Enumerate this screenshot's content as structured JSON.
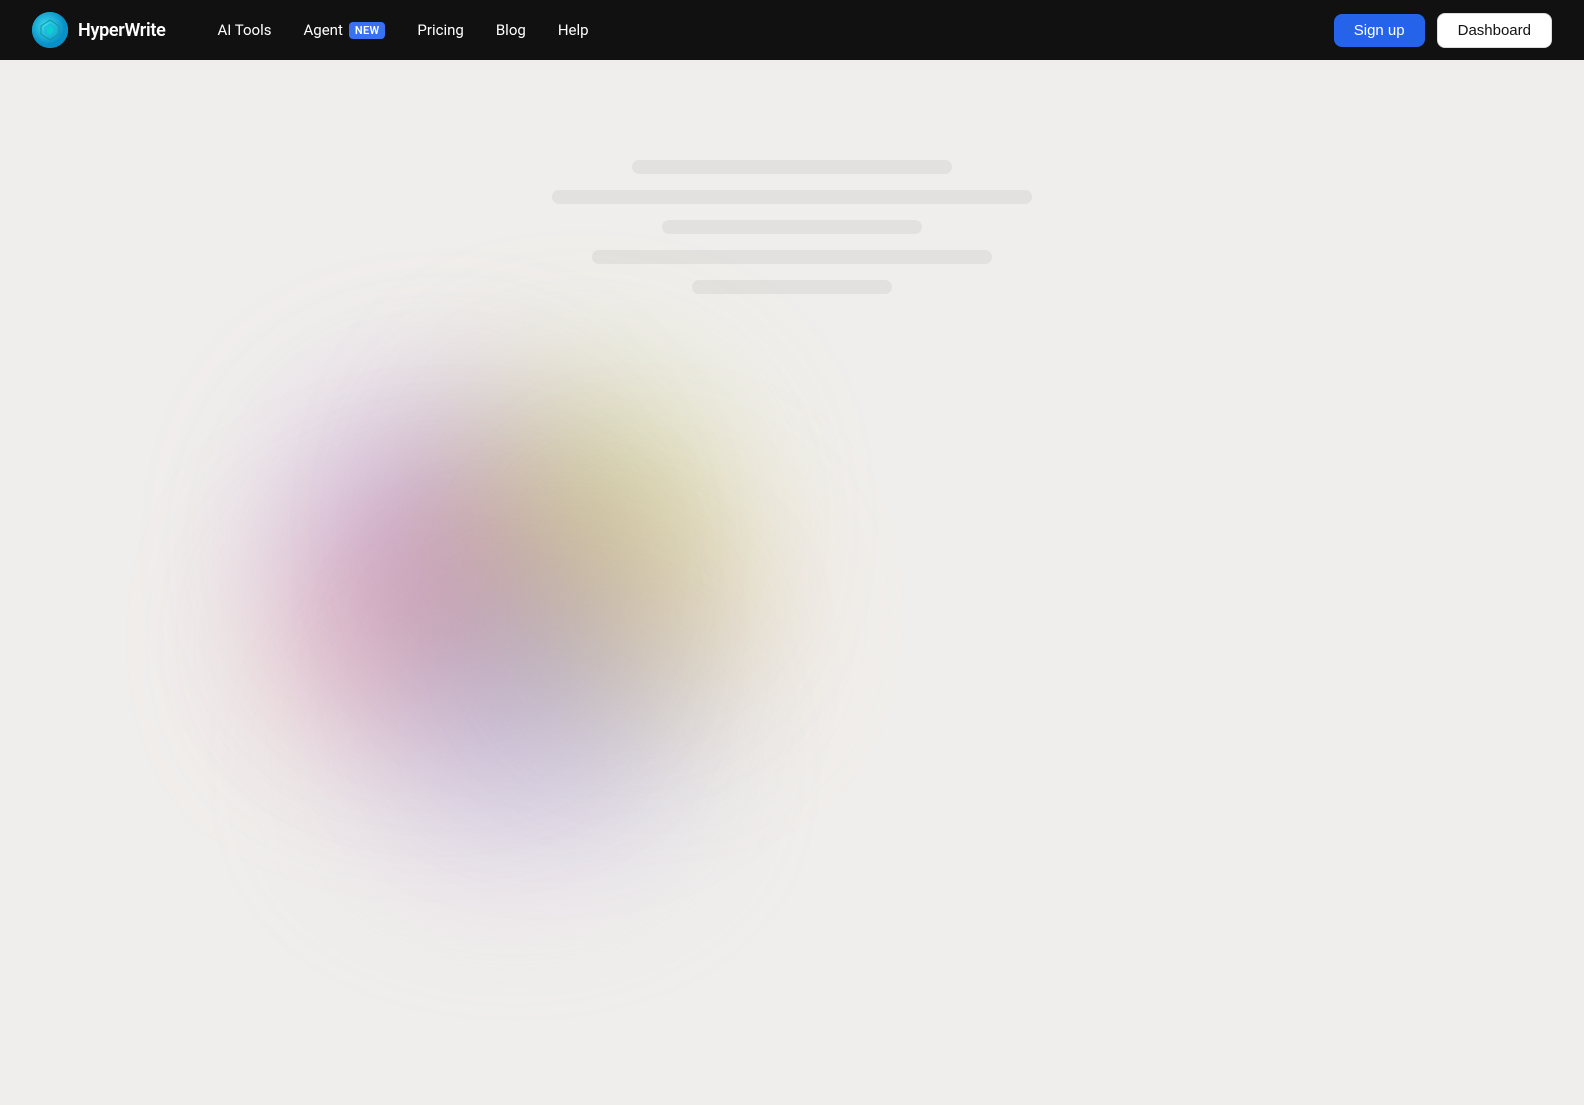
{
  "brand": {
    "name": "HyperWrite",
    "logo_alt": "HyperWrite logo"
  },
  "navbar": {
    "background_color": "#111111",
    "items": [
      {
        "label": "AI Tools",
        "id": "ai-tools",
        "badge": null
      },
      {
        "label": "Agent",
        "id": "agent",
        "badge": "NEW"
      },
      {
        "label": "Pricing",
        "id": "pricing",
        "badge": null
      },
      {
        "label": "Blog",
        "id": "blog",
        "badge": null
      },
      {
        "label": "Help",
        "id": "help",
        "badge": null
      }
    ],
    "actions": {
      "signup_label": "Sign up",
      "dashboard_label": "Dashboard"
    }
  },
  "main": {
    "background_color": "#f0eeec",
    "state": "loading"
  }
}
